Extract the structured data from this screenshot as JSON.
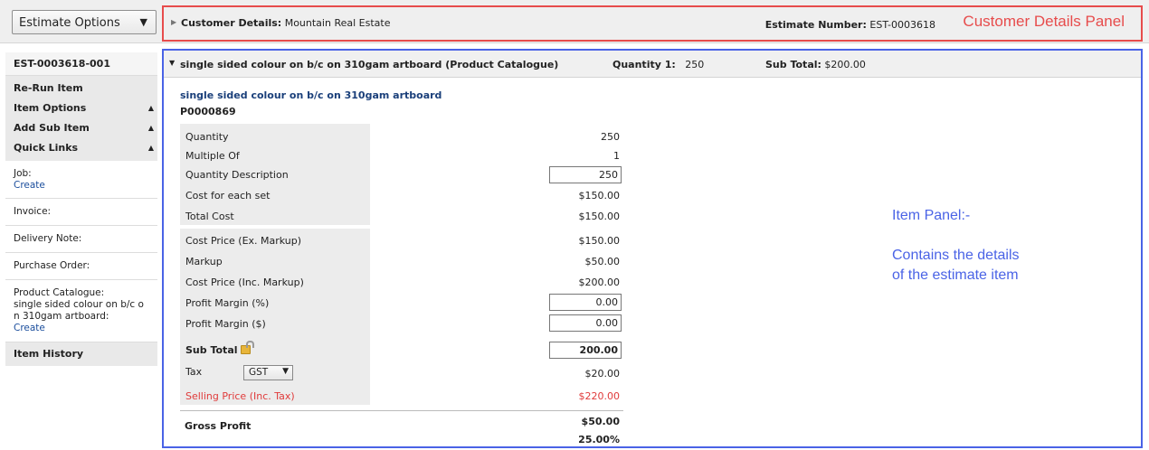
{
  "top": {
    "estimate_options_label": "Estimate Options",
    "customer_label": "Customer Details:",
    "customer_value": "Mountain Real Estate",
    "estimate_number_label": "Estimate Number:",
    "estimate_number_value": "EST-0003618",
    "panel_annotation": "Customer Details Panel"
  },
  "sidebar": {
    "item_id": "EST-0003618-001",
    "menu": {
      "rerun": "Re-Run Item",
      "item_options": "Item Options",
      "add_sub_item": "Add Sub Item",
      "quick_links": "Quick Links"
    },
    "links": {
      "job_label": "Job:",
      "job_action": "Create",
      "invoice_label": "Invoice:",
      "delivery_label": "Delivery Note:",
      "purchase_label": "Purchase Order:",
      "catalogue_label_1": "Product Catalogue:",
      "catalogue_label_2": "single sided colour on b/c o",
      "catalogue_label_3": "n 310gam artboard:",
      "catalogue_action": "Create"
    },
    "history": "Item History"
  },
  "item": {
    "header_title": "single sided colour on b/c on 310gam artboard (Product Catalogue)",
    "header_qty_label": "Quantity 1:",
    "header_qty_value": "250",
    "header_subtotal_label": "Sub Total:",
    "header_subtotal_value": "$200.00",
    "product_name": "single sided colour on b/c on 310gam artboard",
    "product_code": "P0000869",
    "rows": {
      "quantity_label": "Quantity",
      "quantity_value": "250",
      "multiple_label": "Multiple Of",
      "multiple_value": "1",
      "qty_desc_label": "Quantity Description",
      "qty_desc_value": "250",
      "cost_each_label": "Cost for each set",
      "cost_each_value": "$150.00",
      "total_cost_label": "Total Cost",
      "total_cost_value": "$150.00",
      "cost_ex_label": "Cost Price (Ex. Markup)",
      "cost_ex_value": "$150.00",
      "markup_label": "Markup",
      "markup_value": "$50.00",
      "cost_inc_label": "Cost Price (Inc. Markup)",
      "cost_inc_value": "$200.00",
      "margin_pct_label": "Profit Margin (%)",
      "margin_pct_value": "0.00",
      "margin_amt_label": "Profit Margin ($)",
      "margin_amt_value": "0.00",
      "subtotal_label": "Sub Total",
      "subtotal_value": "200.00",
      "tax_label": "Tax",
      "tax_select": "GST",
      "tax_value": "$20.00",
      "selling_label": "Selling Price (Inc. Tax)",
      "selling_value": "$220.00",
      "gross_label": "Gross Profit",
      "gross_value": "$50.00",
      "gross_pct": "25.00%"
    },
    "annotation_1": "Item Panel:-",
    "annotation_2": "Contains the details",
    "annotation_3": "of the estimate item"
  }
}
